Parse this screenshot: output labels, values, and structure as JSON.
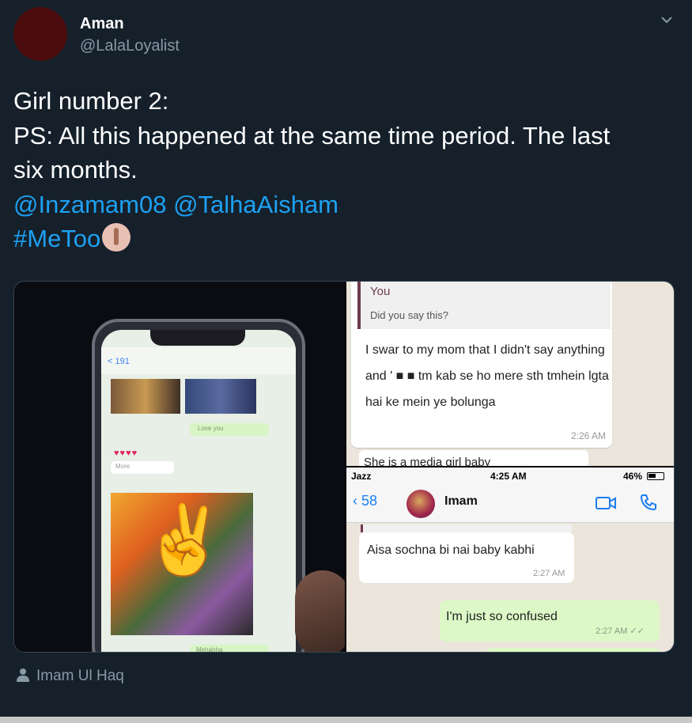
{
  "author": {
    "name": "Aman",
    "handle": "@LalaLoyalist"
  },
  "tweet": {
    "line1": "Girl number 2:",
    "line2": "PS: All this happened at the same time period. The last",
    "line3": "six months.",
    "mention1": "@Inzamam08",
    "mention2": "@TalhaAisham",
    "hashtag": "#MeToo"
  },
  "screenshot_top": {
    "quote_name": "You",
    "quote_text": "Did you say this?",
    "message": "I swar to  my mom that I didn't  say anything and ' ■  ■ tm kab se ho mere sth tmhein lgta hai ke mein ye bolunga",
    "time": "2:26 AM",
    "next_message": "She is a media girl baby"
  },
  "screenshot_bottom": {
    "carrier": "Jazz",
    "time": "4:25 AM",
    "battery": "46%",
    "back_count": "58",
    "contact": "Imam",
    "incoming_text": "Aisa sochna bi nai baby kabhi",
    "incoming_time": "2:27 AM",
    "outgoing_text": "I'm just so confused",
    "outgoing_time": "2:27 AM"
  },
  "phone_photo": {
    "back_label": "< 191",
    "bubble_text_1": "Love you",
    "hearts": "♥♥♥♥",
    "more_label": "More",
    "bottom_label": "Mehahha"
  },
  "attribution": {
    "icon": "person-icon",
    "text": "Imam Ul Haq"
  },
  "colors": {
    "background": "#15202b",
    "link": "#1da1f2",
    "secondary": "#8899a6"
  }
}
